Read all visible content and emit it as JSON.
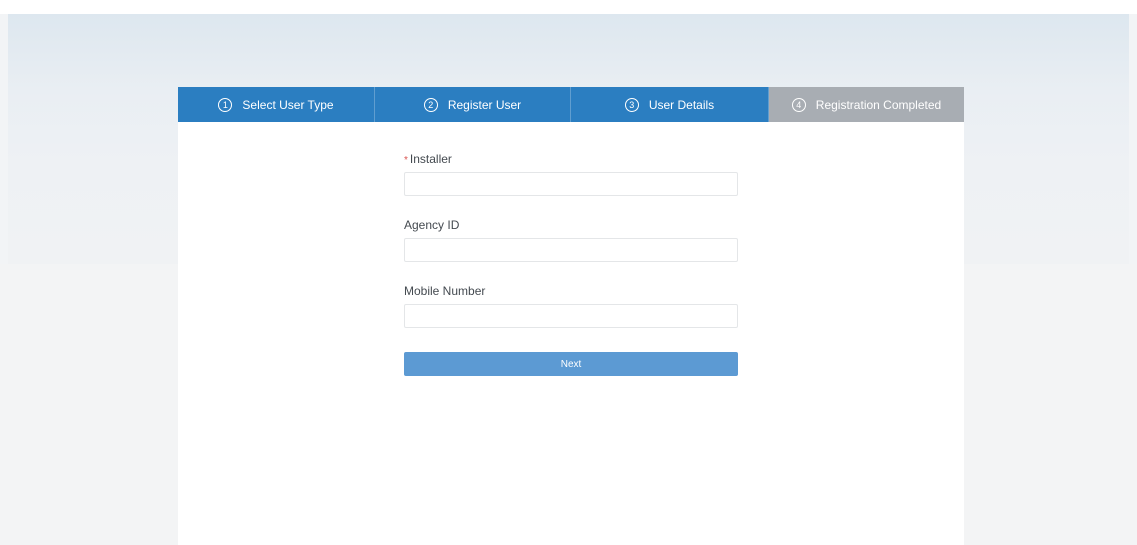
{
  "stepper": {
    "steps": [
      {
        "number": "1",
        "label": "Select User Type",
        "state": "done"
      },
      {
        "number": "2",
        "label": "Register User",
        "state": "done"
      },
      {
        "number": "3",
        "label": "User Details",
        "state": "active"
      },
      {
        "number": "4",
        "label": "Registration Completed",
        "state": "pending"
      }
    ]
  },
  "form": {
    "installer": {
      "required_mark": "*",
      "label": "Installer",
      "value": "",
      "placeholder": ""
    },
    "agency_id": {
      "label": "Agency ID",
      "value": "",
      "placeholder": ""
    },
    "mobile_number": {
      "label": "Mobile Number",
      "value": "",
      "placeholder": ""
    },
    "next_label": "Next"
  },
  "colors": {
    "step_active": "#2b7ec1",
    "step_pending": "#a8adb3",
    "button": "#5c9ad3"
  }
}
